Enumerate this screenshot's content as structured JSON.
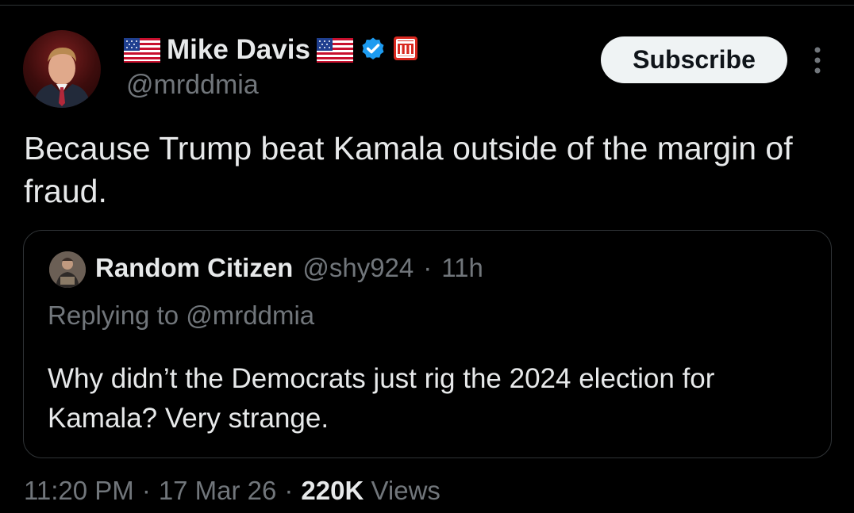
{
  "author": {
    "display_name": "Mike Davis",
    "handle": "@mrddmia",
    "flag_icon": "us-flag-icon",
    "verified_icon": "verified-badge-icon",
    "affiliate_icon": "affiliate-badge-icon",
    "verified_color": "#1d9bf0",
    "affiliate_color": "#d8281f"
  },
  "actions": {
    "subscribe_label": "Subscribe",
    "more_icon": "more-vertical-icon"
  },
  "tweet": {
    "text": "Because Trump beat Kamala outside of the margin of fraud."
  },
  "quote": {
    "name": "Random Citizen",
    "handle": "@shy924",
    "separator": "·",
    "time": "11h",
    "replying_prefix": "Replying to",
    "replying_handle": "@mrddmia",
    "text": "Why didn’t the Democrats just rig the 2024 election for Kamala?  Very strange."
  },
  "meta": {
    "time": "11:20 PM",
    "separator": "·",
    "date": "17 Mar 26",
    "views_count": "220K",
    "views_label": "Views"
  },
  "colors": {
    "background": "#000000",
    "text_primary": "#e7e9ea",
    "text_secondary": "#71767b",
    "border": "#2f3336",
    "button_bg": "#eff3f4"
  }
}
